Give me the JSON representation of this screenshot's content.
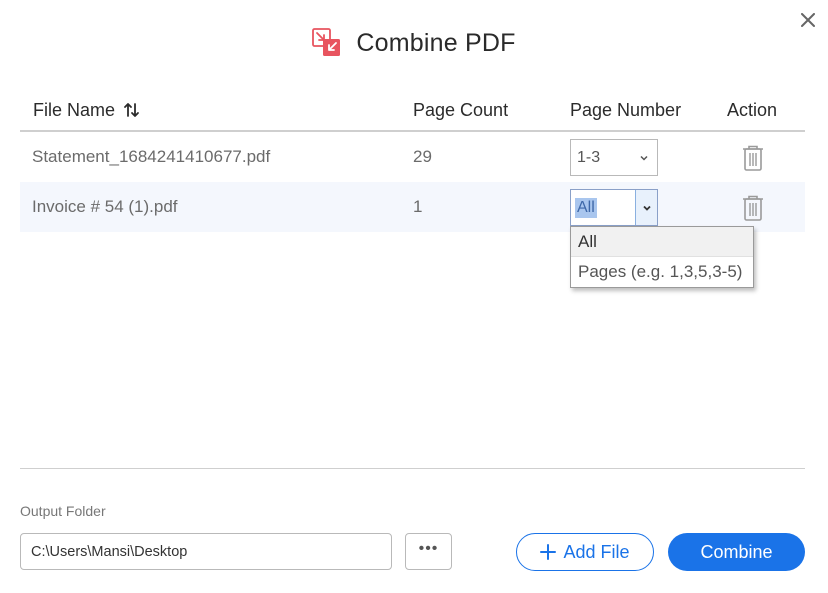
{
  "dialog": {
    "title": "Combine PDF",
    "close_icon": "close-icon",
    "logo_icon": "combine-pdf-icon",
    "accent_color": "#1a73e8",
    "logo_color": "#e8545f"
  },
  "table": {
    "headers": {
      "file_name": "File Name",
      "page_count": "Page Count",
      "page_number": "Page Number",
      "action": "Action"
    },
    "rows": [
      {
        "file_name": "Statement_1684241410677.pdf",
        "page_count": "29",
        "page_number": "1-3",
        "action_icon": "trash-icon"
      },
      {
        "file_name": "Invoice # 54 (1).pdf",
        "page_count": "1",
        "page_number": "All",
        "action_icon": "trash-icon"
      }
    ]
  },
  "page_number_dropdown": {
    "open_for_row": 1,
    "options": [
      "All",
      "Pages (e.g. 1,3,5,3-5)"
    ],
    "selected": "All"
  },
  "output": {
    "label": "Output Folder",
    "path": "C:\\Users\\Mansi\\Desktop",
    "browse_label": "•••"
  },
  "buttons": {
    "add_file": "Add File",
    "combine": "Combine"
  }
}
